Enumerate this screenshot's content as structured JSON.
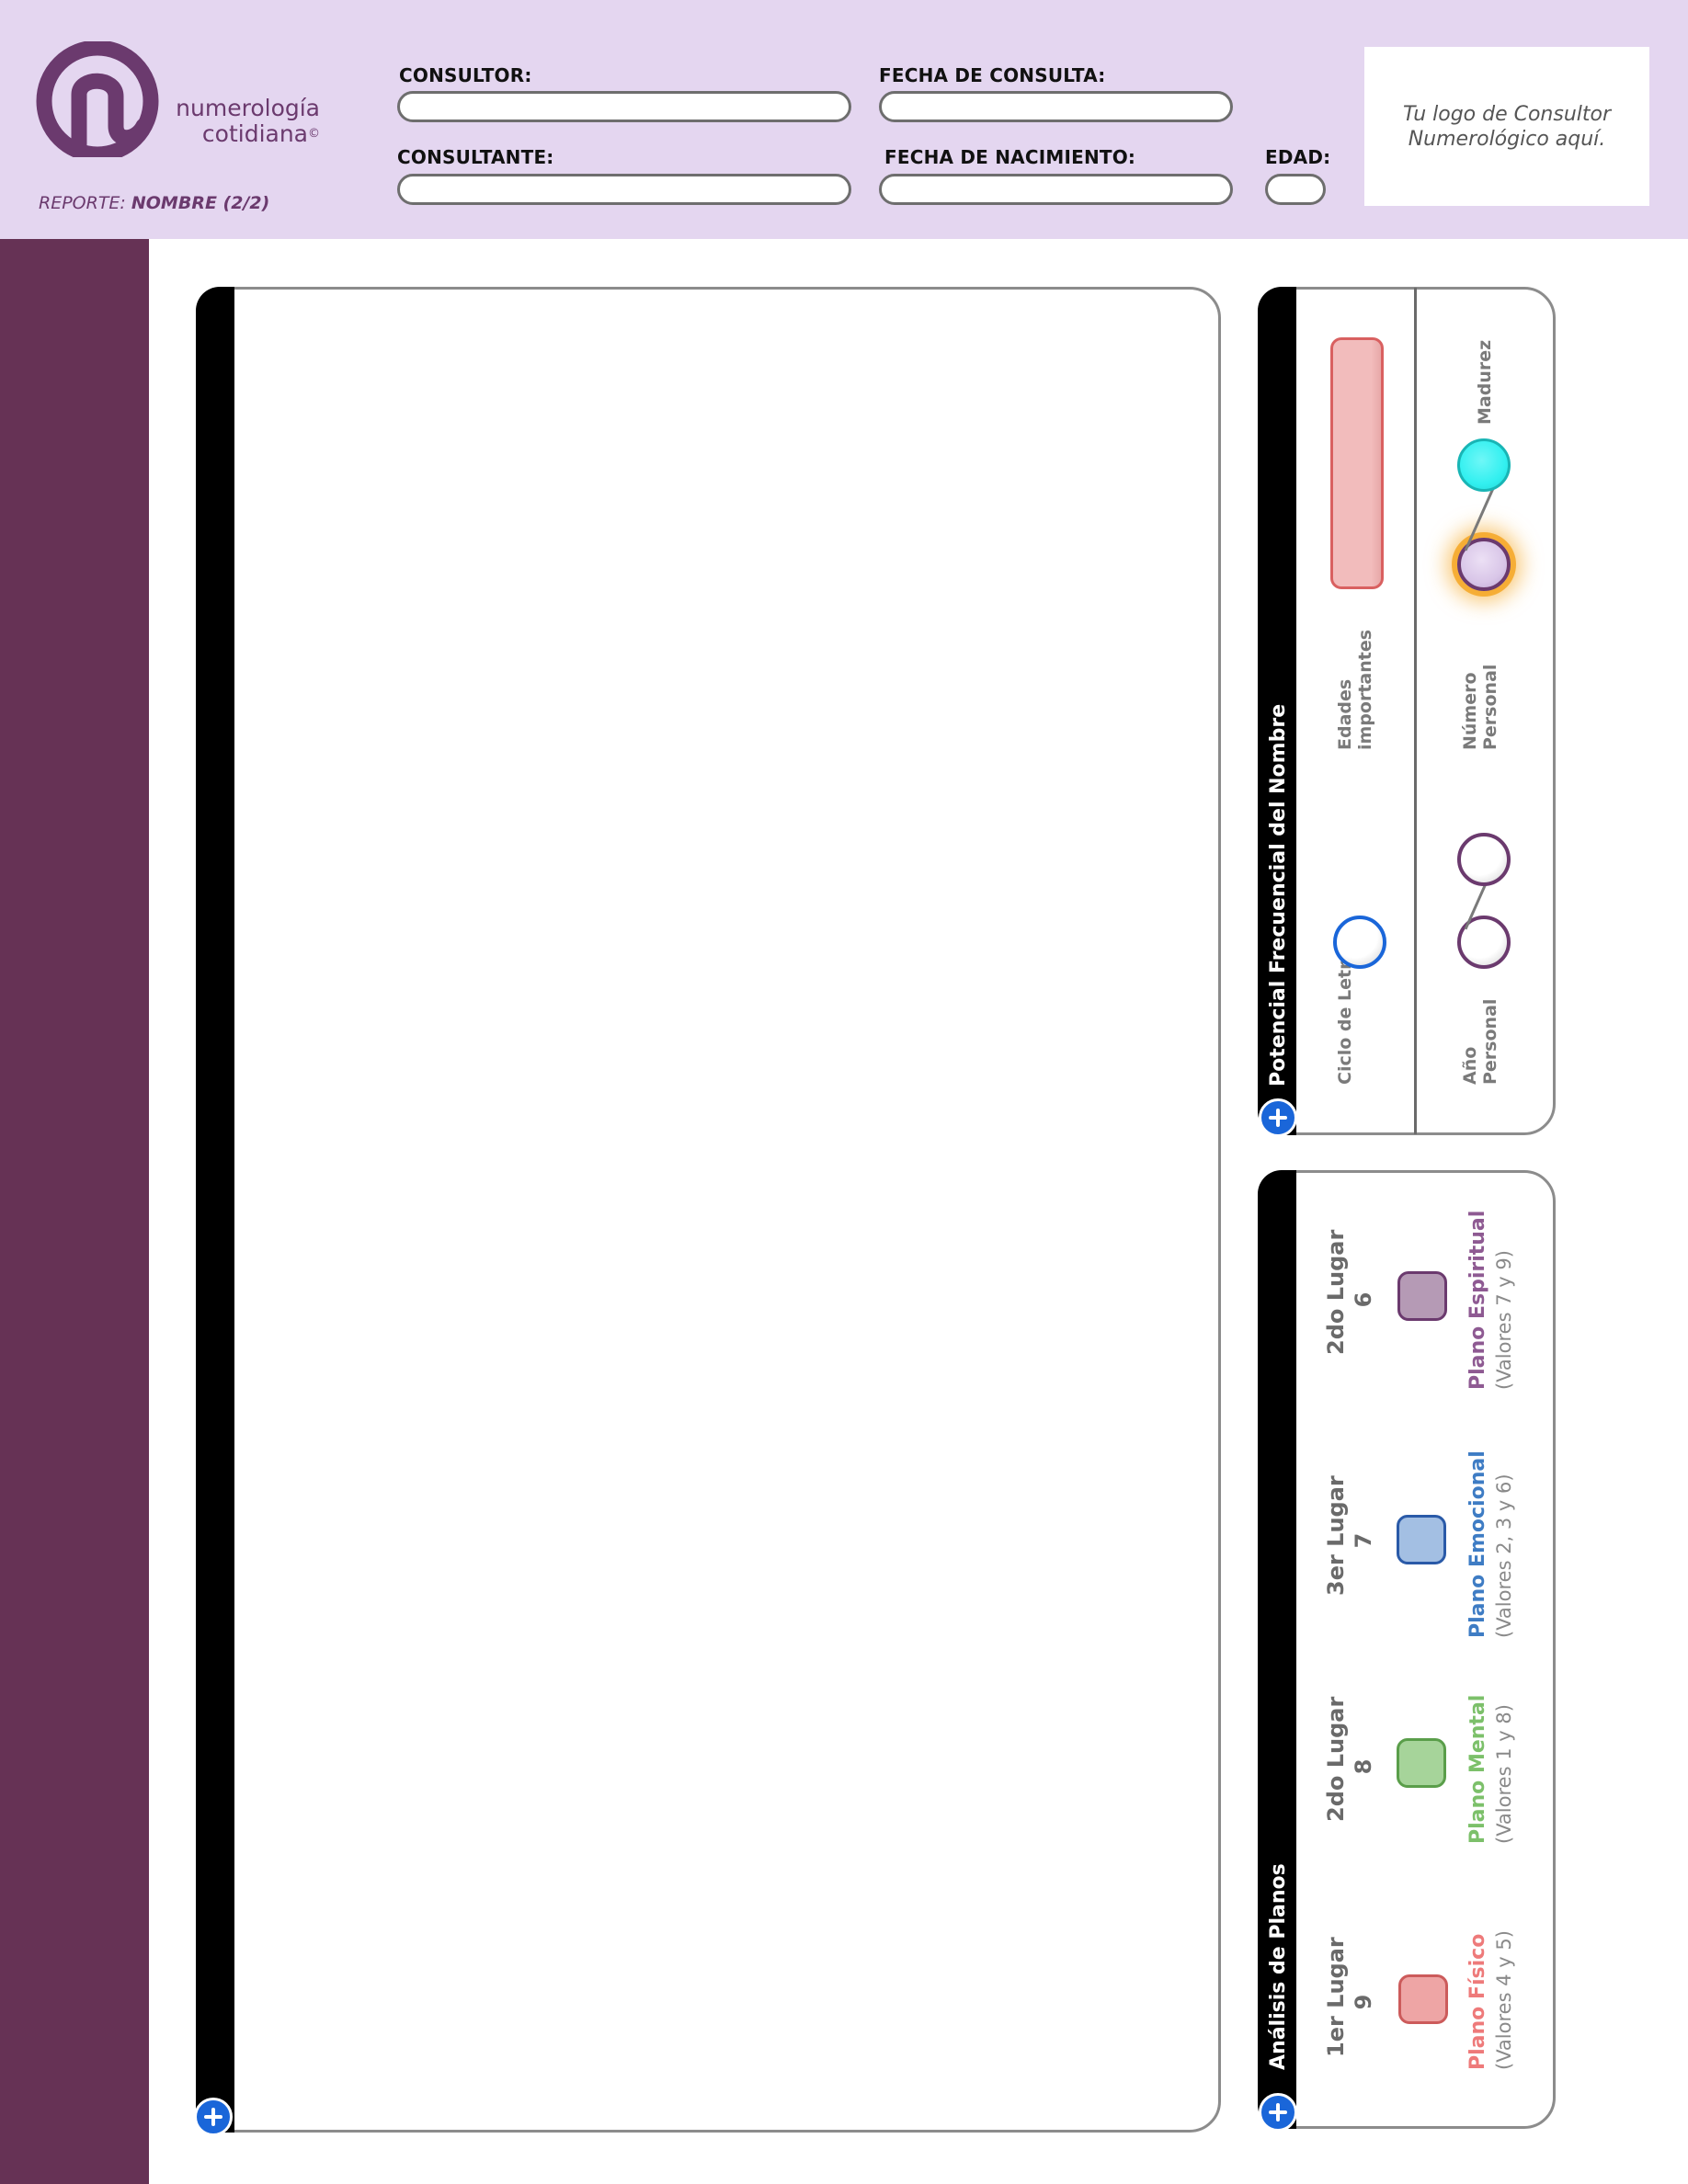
{
  "header": {
    "brand_line1": "numerología",
    "brand_line2": "cotidiana",
    "copyright": "©",
    "report_prefix": "REPORTE: ",
    "report_name": "NOMBRE (2/2)",
    "consultor_label": "CONSULTOR:",
    "consultor_value": "",
    "fecha_consulta_label": "FECHA DE CONSULTA:",
    "fecha_consulta_value": "",
    "consultante_label": "CONSULTANTE:",
    "consultante_value": "",
    "fecha_nacimiento_label": "FECHA DE NACIMIENTO:",
    "fecha_nacimiento_value": "",
    "edad_label": "EDAD:",
    "edad_value": "",
    "logo_placeholder": "Tu logo de Consultor Numerológico aquí."
  },
  "potencial": {
    "title": "Potencial Frecuencial del Nombre",
    "ciclo_letras_label": "Ciclo de Letras",
    "edades_label": "Edades importantes",
    "ano_personal_label": "Año Personal",
    "numero_personal_label": "Número Personal",
    "madurez_label": "Madurez"
  },
  "planos": {
    "title": "Análisis de Planos",
    "items": [
      {
        "place": "1er Lugar",
        "value": "9",
        "name": "Plano Físico",
        "sub": "(Valores 4 y 5)",
        "color": "#ee7a7a",
        "fill": "#eea5a5",
        "border": "#cc5b5b"
      },
      {
        "place": "2do Lugar",
        "value": "8",
        "name": "Plano Mental",
        "sub": "(Valores 1 y 8)",
        "color": "#7cc06a",
        "fill": "#a6d49a",
        "border": "#5a9e4a"
      },
      {
        "place": "3er Lugar",
        "value": "7",
        "name": "Plano Emocional",
        "sub": "(Valores 2, 3 y 6)",
        "color": "#3e7cc4",
        "fill": "#a3bfe3",
        "border": "#2a5aa8"
      },
      {
        "place": "2do Lugar",
        "value": "6",
        "name": "Plano Espiritual",
        "sub": "(Valores 7 y 9)",
        "color": "#8e5a92",
        "fill": "#b59ab5",
        "border": "#6b3a6e"
      }
    ]
  },
  "colors": {
    "header_bg": "#e4d6f0",
    "sidebar": "#663255",
    "brand": "#6b3a6e",
    "button_blue": "#1a66d9",
    "edades_fill": "#f2bcbc",
    "madurez_fill": "#33f0f0",
    "numero_fill": "#d9c6e8",
    "numero_glow": "#f5a623"
  },
  "icons": {
    "logo": "numerologia-logo-icon",
    "add": "plus-icon"
  }
}
